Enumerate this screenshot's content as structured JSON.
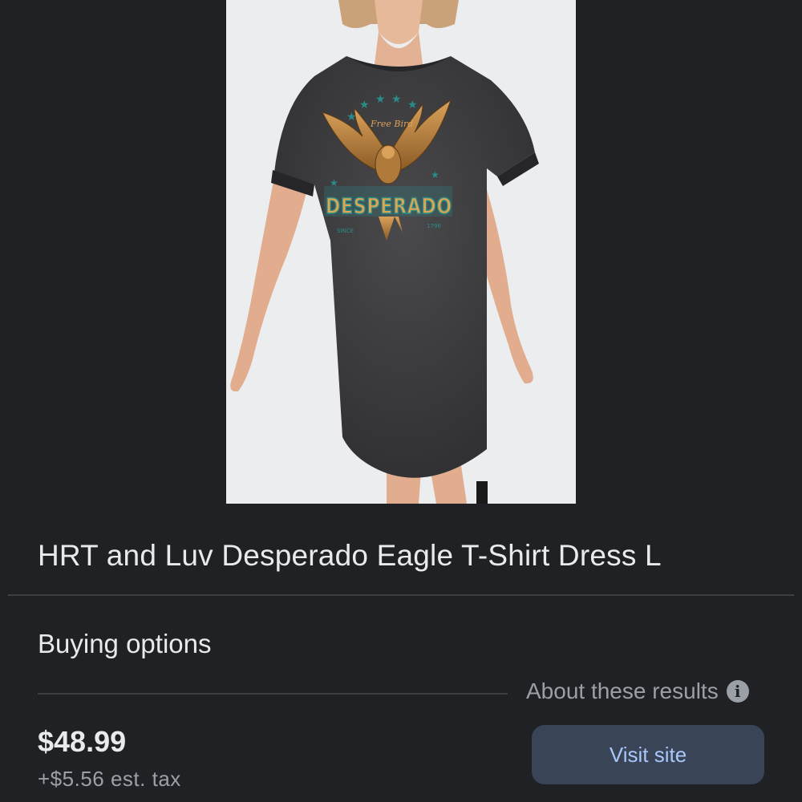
{
  "product": {
    "image_alt": "HRT and Luv Desperado Eagle T-Shirt Dress",
    "graphic_text": {
      "script": "Free Bird",
      "logo": "DESPERADO",
      "since": "SINCE",
      "year": "1796"
    },
    "title": "HRT and Luv Desperado Eagle T-Shirt Dress L"
  },
  "buying_options": {
    "heading": "Buying options",
    "about_label": "About these results",
    "about_icon": "info-icon"
  },
  "offer": {
    "price": "$48.99",
    "tax": "+$5.56 est. tax",
    "visit_label": "Visit site"
  },
  "colors": {
    "background": "#202124",
    "button_bg": "#394457",
    "button_text": "#a8c7fa",
    "secondary_text": "#9aa0a6"
  }
}
